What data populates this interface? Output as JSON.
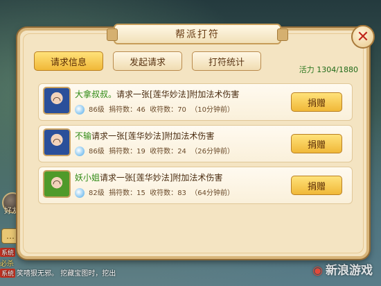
{
  "window": {
    "title": "帮派打符"
  },
  "tabs": [
    {
      "label": "请求信息",
      "active": true
    },
    {
      "label": "发起请求",
      "active": false
    },
    {
      "label": "打符统计",
      "active": false
    }
  ],
  "vitality": {
    "label": "活力",
    "value": "1304/1880"
  },
  "requests": [
    {
      "name": "大拿叔叔。",
      "text": "请求一张[莲华妙法]附加法术伤害",
      "level": "86级",
      "donated_label": "捐符数：",
      "donated": "46",
      "received_label": "收符数：",
      "received": "70",
      "time": "（10分钟前）",
      "button": "捐赠",
      "avatar_color": "blue"
    },
    {
      "name": "不输",
      "text": "请求一张[莲华妙法]附加法术伤害",
      "level": "86级",
      "donated_label": "捐符数：",
      "donated": "19",
      "received_label": "收符数：",
      "received": "24",
      "time": "（26分钟前）",
      "button": "捐赠",
      "avatar_color": "blue"
    },
    {
      "name": "妖小姐",
      "text": "请求一张[莲华妙法]附加法术伤害",
      "level": "82级",
      "donated_label": "捐符数：",
      "donated": "15",
      "received_label": "收符数：",
      "received": "83",
      "time": "（64分钟前）",
      "button": "捐赠",
      "avatar_color": "green"
    }
  ],
  "background": {
    "hud_label": "好友",
    "chat": [
      {
        "tag": "系统",
        "tag_color": "#c03020",
        "text": ""
      },
      {
        "tag": "",
        "tag_color": "",
        "text": "必杀"
      },
      {
        "tag": "系统",
        "tag_color": "#c03020",
        "text": "笑嘻狠无邪。  挖藏宝图时，挖出"
      }
    ]
  },
  "watermark": {
    "text": "新浪游戏",
    "logo": "sina"
  },
  "colors": {
    "accent": "#f0b838",
    "panel": "#f4e4c2",
    "name_green": "#2e8a14"
  }
}
